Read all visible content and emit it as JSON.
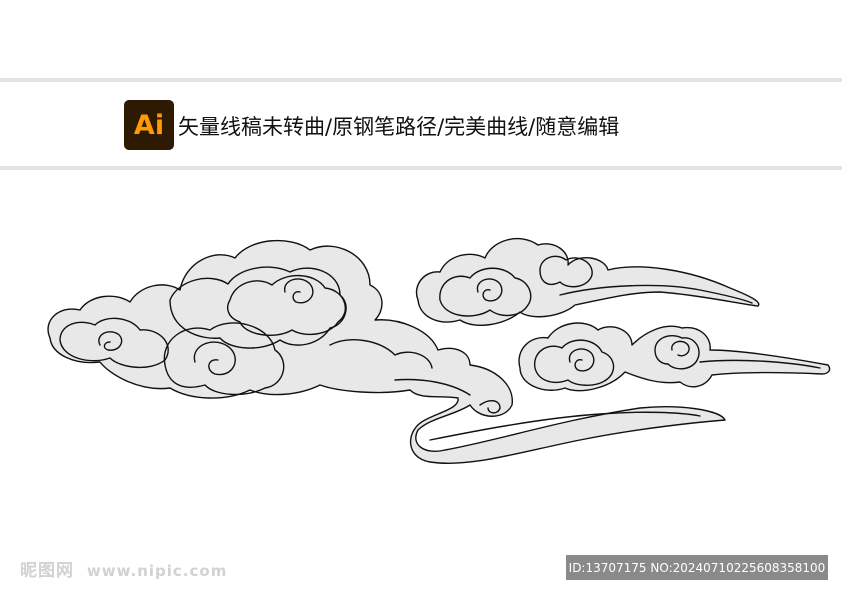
{
  "header": {
    "logo_text": "Ai",
    "caption": "矢量线稿未转曲/原钢笔路径/完美曲线/随意编辑"
  },
  "artwork": {
    "subject": "clouds-line-art",
    "colors": {
      "stroke": "#111111",
      "fill": "#e8e8e8"
    }
  },
  "watermark": {
    "site_name": "昵图网",
    "site_url": "www.nipic.com",
    "id_text": "ID:13707175 NO:20240710225608358100"
  },
  "colors": {
    "logo_bg": "#2e1a03",
    "logo_text": "#ff9a00",
    "banner_border": "#e4e4e4",
    "id_box": "#8a8a8a"
  }
}
